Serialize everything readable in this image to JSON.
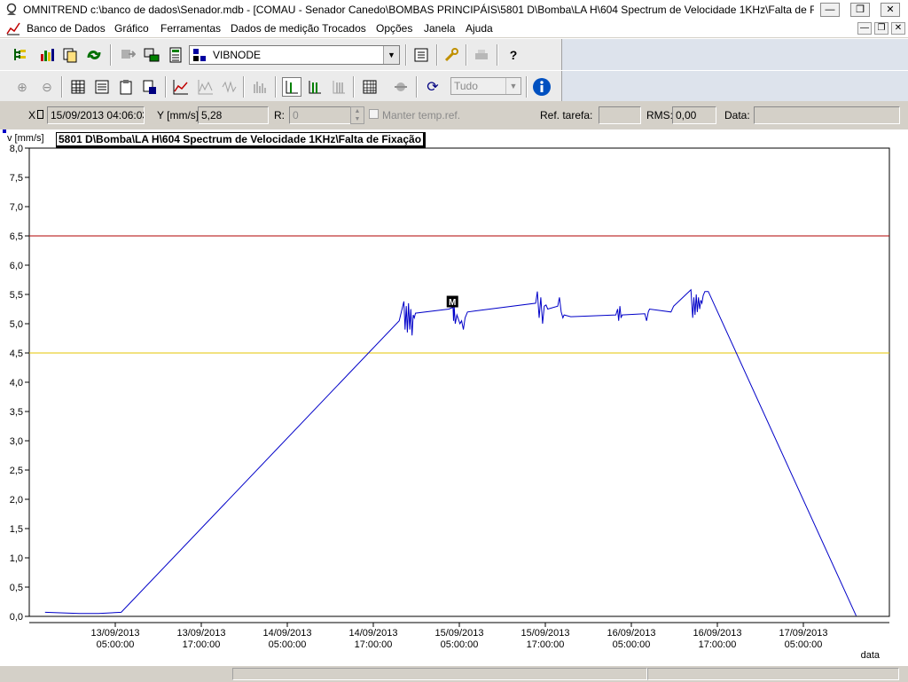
{
  "window": {
    "title": "OMNITREND c:\\banco de dados\\Senador.mdb - [COMAU - Senador Canedo\\BOMBAS PRINCIPÁIS\\5801 D\\Bomba\\LA H\\604 Spectrum de Velocidade 1KHz\\Falta de Fix..."
  },
  "menu": [
    "Banco de Dados",
    "Gráfico",
    "Ferramentas",
    "Dados de medição Trocados",
    "Opções",
    "Janela",
    "Ajuda"
  ],
  "toolbar": {
    "device_combo": "VIBNODE",
    "range_combo": "Tudo"
  },
  "info": {
    "x_label": "X",
    "x_value": "15/09/2013 04:06:03",
    "y_label": "Y [mm/s]",
    "y_value": "5,28",
    "r_label": "R:",
    "r_value": "0",
    "hold_label": "Manter temp.ref.",
    "ref_label": "Ref. tarefa:",
    "ref_value": "",
    "rms_label": "RMS:",
    "rms_value": "0,00",
    "data_label": "Data:",
    "data_value": ""
  },
  "colors": {
    "series": "#0000c8",
    "alarm_high": "#b00000",
    "alarm_warning": "#e6c400"
  },
  "chart_data": {
    "type": "line",
    "title": "5801 D\\Bomba\\LA H\\604 Spectrum de Velocidade 1KHz\\Falta de Fixação",
    "ylabel": "v [mm/s]",
    "xlabel": "data",
    "ylim": [
      0,
      8
    ],
    "yticks": [
      "0,0",
      "0,5",
      "1,0",
      "1,5",
      "2,0",
      "2,5",
      "3,0",
      "3,5",
      "4,0",
      "4,5",
      "5,0",
      "5,5",
      "6,0",
      "6,5",
      "7,0",
      "7,5",
      "8,0"
    ],
    "x_ticks": [
      {
        "date": "13/09/2013",
        "time": "05:00:00"
      },
      {
        "date": "13/09/2013",
        "time": "17:00:00"
      },
      {
        "date": "14/09/2013",
        "time": "05:00:00"
      },
      {
        "date": "14/09/2013",
        "time": "17:00:00"
      },
      {
        "date": "15/09/2013",
        "time": "05:00:00"
      },
      {
        "date": "15/09/2013",
        "time": "17:00:00"
      },
      {
        "date": "16/09/2013",
        "time": "05:00:00"
      },
      {
        "date": "16/09/2013",
        "time": "17:00:00"
      },
      {
        "date": "17/09/2013",
        "time": "05:00:00"
      }
    ],
    "x_range": [
      "12/09/2013 17:00",
      "17/09/2013 17:00"
    ],
    "alarm_lines": [
      {
        "value": 6.5,
        "color": "#b00000"
      },
      {
        "value": 4.5,
        "color": "#e6c400"
      }
    ],
    "marker": {
      "label": "M",
      "x": "15/09/2013 04:06:03",
      "y": 5.28
    },
    "series": [
      {
        "x": [
          "12/09/2013 19:12",
          "12/09/2013 23:57",
          "13/09/2013 02:40",
          "13/09/2013 05:50",
          "14/09/2013 20:37",
          "14/09/2013 21:16",
          "14/09/2013 21:26",
          "14/09/2013 21:36",
          "14/09/2013 21:45",
          "14/09/2013 21:55",
          "14/09/2013 22:05",
          "14/09/2013 22:14",
          "14/09/2013 22:24",
          "14/09/2013 22:34",
          "14/09/2013 22:43",
          "14/09/2013 22:53",
          "15/09/2013 03:33",
          "15/09/2013 04:07",
          "15/09/2013 04:12",
          "15/09/2013 04:17",
          "15/09/2013 04:26",
          "15/09/2013 04:40",
          "15/09/2013 05:05",
          "15/09/2013 05:19",
          "15/09/2013 05:34",
          "15/09/2013 05:48",
          "15/09/2013 06:08",
          "15/09/2013 07:18",
          "15/09/2013 15:39",
          "15/09/2013 15:53",
          "15/09/2013 16:08",
          "15/09/2013 16:22",
          "15/09/2013 16:37",
          "15/09/2013 16:51",
          "15/09/2013 17:06",
          "15/09/2013 17:20",
          "15/09/2013 18:44",
          "15/09/2013 18:58",
          "15/09/2013 19:13",
          "15/09/2013 19:27",
          "15/09/2013 19:37",
          "15/09/2013 20:33",
          "16/09/2013 02:50",
          "16/09/2013 03:05",
          "16/09/2013 03:14",
          "16/09/2013 03:24",
          "16/09/2013 03:34",
          "16/09/2013 03:43",
          "16/09/2013 06:53",
          "16/09/2013 07:08",
          "16/09/2013 07:22",
          "16/09/2013 07:32",
          "16/09/2013 10:32",
          "16/09/2013 10:54",
          "16/09/2013 13:19",
          "16/09/2013 13:34",
          "16/09/2013 13:43",
          "16/09/2013 13:53",
          "16/09/2013 14:03",
          "16/09/2013 14:12",
          "16/09/2013 14:22",
          "16/09/2013 14:32",
          "16/09/2013 14:41",
          "16/09/2013 14:51",
          "16/09/2013 15:01",
          "16/09/2013 15:15",
          "16/09/2013 15:44",
          "17/09/2013 12:22"
        ],
        "values": [
          0.07,
          0.05,
          0.05,
          0.07,
          5.05,
          5.38,
          4.9,
          5.3,
          4.85,
          5.35,
          4.9,
          5.25,
          4.8,
          5.15,
          5.1,
          5.18,
          5.25,
          5.28,
          5.05,
          5.3,
          5.0,
          5.15,
          5.0,
          5.05,
          4.9,
          5.1,
          5.2,
          5.22,
          5.35,
          5.55,
          5.1,
          5.45,
          5.0,
          5.3,
          5.32,
          5.25,
          5.3,
          5.45,
          5.2,
          5.1,
          5.15,
          5.12,
          5.15,
          5.25,
          5.05,
          5.3,
          5.1,
          5.15,
          5.17,
          5.05,
          5.2,
          5.25,
          5.2,
          5.3,
          5.58,
          5.1,
          5.45,
          5.15,
          5.5,
          5.2,
          5.45,
          5.25,
          5.4,
          5.35,
          5.48,
          5.55,
          5.55,
          0.01
        ]
      }
    ]
  }
}
